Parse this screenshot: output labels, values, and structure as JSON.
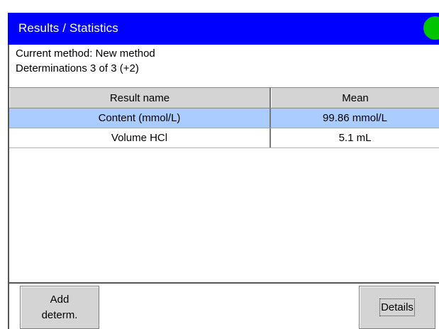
{
  "header": {
    "title": "Results / Statistics",
    "status_color": "#00c400",
    "bar_color": "#0000ff"
  },
  "info": {
    "method": "Current method: New method",
    "determinations": "Determinations 3 of 3 (+2)"
  },
  "table": {
    "columns": [
      "Result name",
      "Mean"
    ],
    "rows": [
      {
        "name": "Content (mmol/L)",
        "mean": "99.86 mmol/L",
        "selected": true
      },
      {
        "name": "Volume HCl",
        "mean": "5.1 mL",
        "selected": false
      }
    ]
  },
  "buttons": {
    "add_line1": "Add",
    "add_line2": "determ.",
    "details": "Details"
  }
}
